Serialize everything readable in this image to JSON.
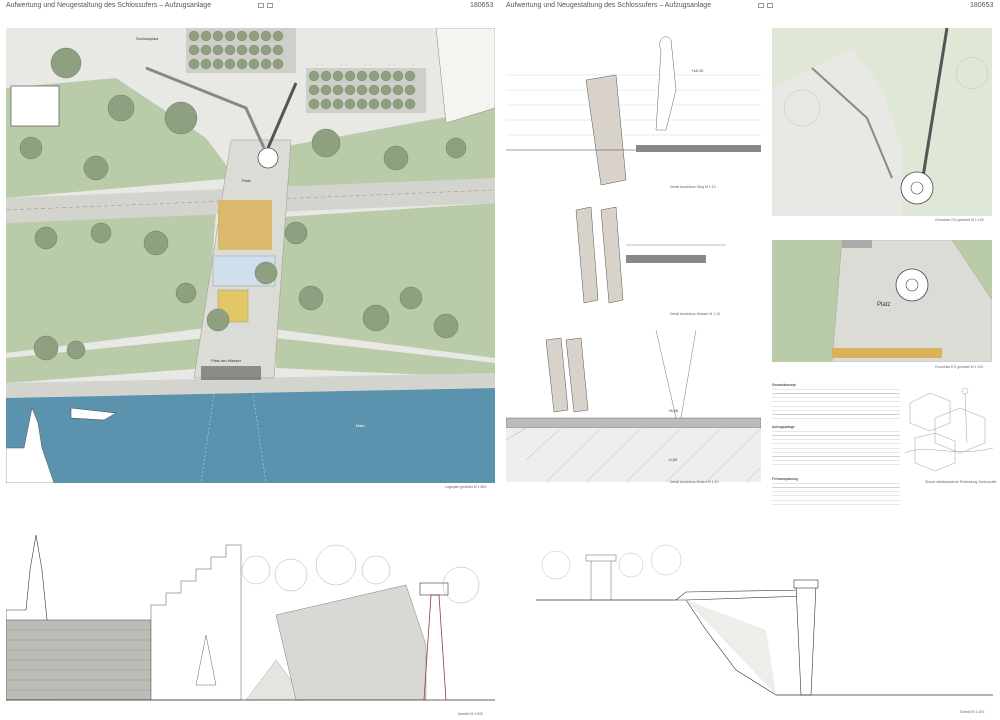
{
  "sheet_left": {
    "header": "Aufwertung und Neugestaltung des Schlossufers – Aufzugsanlage",
    "number": "180653",
    "plan_caption": "Lageplan gesüdet M 1:500",
    "elevation_caption": "Ansicht M 1:500",
    "labels": {
      "schlossplatz": "Schlossplatz",
      "platz": "Platz",
      "platz_am_wasser": "Platz am Wasser",
      "main": "Main",
      "landing": "Landing"
    }
  },
  "sheet_right": {
    "header": "Aufwertung und Neugestaltung des Schlossufers – Aufzugsanlage",
    "number": "180653",
    "detail_captions": [
      "Detail Anschluss Steg M 1:10",
      "Detail Anschluss Wasser M 1:10",
      "Detail Anschluss Boden M 1:10"
    ],
    "detail_levels": [
      "+18,10",
      "+8,60",
      "-0,50"
    ],
    "plan_captions": [
      "Grundriss OG gesüdet M 1:100",
      "Grundriss EG gesüdet M 1:100"
    ],
    "platz_label": "Platz",
    "text_headings": [
      "Gesamtkonzept",
      "Aufzugsanlage",
      "Freiraumplanung"
    ],
    "sketch_caption": "Skizze städtebauliche Einbindung Schlossufer",
    "section_caption": "Schnitt M 1:100"
  },
  "colors": {
    "lawn": "#b9cba8",
    "path": "#d4d4cf",
    "tree": "#8ea07f",
    "water": "#5b93ae",
    "gravel": "#d9b25a"
  }
}
